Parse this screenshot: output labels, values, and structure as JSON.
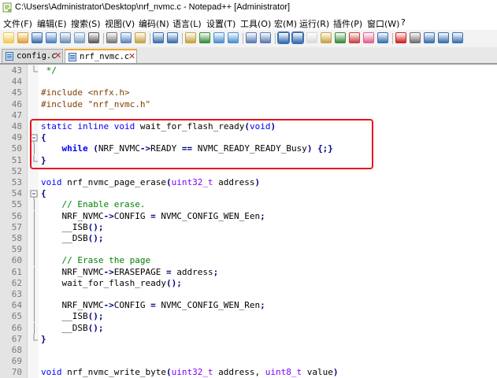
{
  "window": {
    "title": "C:\\Users\\Administrator\\Desktop\\nrf_nvmc.c - Notepad++ [Administrator]"
  },
  "menu": [
    {
      "label": "文件(F)"
    },
    {
      "label": "编辑(E)"
    },
    {
      "label": "搜索(S)"
    },
    {
      "label": "视图(V)"
    },
    {
      "label": "编码(N)"
    },
    {
      "label": "语言(L)"
    },
    {
      "label": "设置(T)"
    },
    {
      "label": "工具(O)"
    },
    {
      "label": "宏(M)"
    },
    {
      "label": "运行(R)"
    },
    {
      "label": "插件(P)"
    },
    {
      "label": "窗口(W)"
    },
    {
      "label": "?"
    }
  ],
  "toolbar_icons": [
    "new-file",
    "open-file",
    "save",
    "save-all",
    "close",
    "close-all",
    "print",
    "cut",
    "copy",
    "paste",
    "undo",
    "redo",
    "find",
    "replace",
    "zoom-in",
    "zoom-out",
    "sync-vertical",
    "sync-horizontal",
    "word-wrap",
    "show-all-chars",
    "indent-guide",
    "user-language",
    "doc-map",
    "function-list",
    "folder-workspace",
    "monitor",
    "record-macro",
    "stop-record",
    "play-macro",
    "run-macro-multiple",
    "save-macro"
  ],
  "tabs": [
    {
      "label": "config.c",
      "active": false
    },
    {
      "label": "nrf_nvmc.c",
      "active": true
    }
  ],
  "editor": {
    "lines": [
      {
        "num": "43",
        "fold": "end",
        "tokens": [
          {
            "t": " */",
            "c": "com"
          }
        ]
      },
      {
        "num": "44",
        "fold": "",
        "tokens": []
      },
      {
        "num": "45",
        "fold": "",
        "tokens": [
          {
            "t": "#include ",
            "c": "pp"
          },
          {
            "t": "<nrfx.h>",
            "c": "pp"
          }
        ]
      },
      {
        "num": "46",
        "fold": "",
        "tokens": [
          {
            "t": "#include ",
            "c": "pp"
          },
          {
            "t": "\"nrf_nvmc.h\"",
            "c": "pp"
          }
        ]
      },
      {
        "num": "47",
        "fold": "",
        "tokens": []
      },
      {
        "num": "48",
        "fold": "",
        "tokens": [
          {
            "t": "static",
            "c": "kw"
          },
          {
            "t": " ",
            "c": "txt"
          },
          {
            "t": "inline",
            "c": "kw"
          },
          {
            "t": " ",
            "c": "txt"
          },
          {
            "t": "void",
            "c": "kw"
          },
          {
            "t": " wait_for_flash_ready",
            "c": "txt"
          },
          {
            "t": "(",
            "c": "op"
          },
          {
            "t": "void",
            "c": "kw"
          },
          {
            "t": ")",
            "c": "op"
          }
        ]
      },
      {
        "num": "49",
        "fold": "open",
        "tokens": [
          {
            "t": "{",
            "c": "op"
          }
        ]
      },
      {
        "num": "50",
        "fold": "mid",
        "tokens": [
          {
            "t": "    ",
            "c": "txt"
          },
          {
            "t": "while",
            "c": "kwb"
          },
          {
            "t": " ",
            "c": "txt"
          },
          {
            "t": "(",
            "c": "op"
          },
          {
            "t": "NRF_NVMC",
            "c": "txt"
          },
          {
            "t": "->",
            "c": "op"
          },
          {
            "t": "READY ",
            "c": "txt"
          },
          {
            "t": "==",
            "c": "op"
          },
          {
            "t": " NVMC_READY_READY_Busy",
            "c": "txt"
          },
          {
            "t": ")",
            "c": "op"
          },
          {
            "t": " ",
            "c": "txt"
          },
          {
            "t": "{;}",
            "c": "op"
          }
        ]
      },
      {
        "num": "51",
        "fold": "end",
        "tokens": [
          {
            "t": "}",
            "c": "op"
          }
        ]
      },
      {
        "num": "52",
        "fold": "",
        "tokens": []
      },
      {
        "num": "53",
        "fold": "",
        "tokens": [
          {
            "t": "void",
            "c": "kw"
          },
          {
            "t": " nrf_nvmc_page_erase",
            "c": "txt"
          },
          {
            "t": "(",
            "c": "op"
          },
          {
            "t": "uint32_t",
            "c": "type"
          },
          {
            "t": " address",
            "c": "txt"
          },
          {
            "t": ")",
            "c": "op"
          }
        ]
      },
      {
        "num": "54",
        "fold": "open",
        "tokens": [
          {
            "t": "{",
            "c": "op"
          }
        ]
      },
      {
        "num": "55",
        "fold": "mid",
        "tokens": [
          {
            "t": "    // Enable erase.",
            "c": "com"
          }
        ]
      },
      {
        "num": "56",
        "fold": "mid",
        "tokens": [
          {
            "t": "    NRF_NVMC",
            "c": "txt"
          },
          {
            "t": "->",
            "c": "op"
          },
          {
            "t": "CONFIG ",
            "c": "txt"
          },
          {
            "t": "=",
            "c": "op"
          },
          {
            "t": " NVMC_CONFIG_WEN_Een",
            "c": "txt"
          },
          {
            "t": ";",
            "c": "op"
          }
        ]
      },
      {
        "num": "57",
        "fold": "mid",
        "tokens": [
          {
            "t": "    __ISB",
            "c": "txt"
          },
          {
            "t": "();",
            "c": "op"
          }
        ]
      },
      {
        "num": "58",
        "fold": "mid",
        "tokens": [
          {
            "t": "    __DSB",
            "c": "txt"
          },
          {
            "t": "();",
            "c": "op"
          }
        ]
      },
      {
        "num": "59",
        "fold": "mid",
        "tokens": []
      },
      {
        "num": "60",
        "fold": "mid",
        "tokens": [
          {
            "t": "    // Erase the page",
            "c": "com"
          }
        ]
      },
      {
        "num": "61",
        "fold": "mid",
        "tokens": [
          {
            "t": "    NRF_NVMC",
            "c": "txt"
          },
          {
            "t": "->",
            "c": "op"
          },
          {
            "t": "ERASEPAGE ",
            "c": "txt"
          },
          {
            "t": "=",
            "c": "op"
          },
          {
            "t": " address",
            "c": "txt"
          },
          {
            "t": ";",
            "c": "op"
          }
        ]
      },
      {
        "num": "62",
        "fold": "mid",
        "tokens": [
          {
            "t": "    wait_for_flash_ready",
            "c": "txt"
          },
          {
            "t": "();",
            "c": "op"
          }
        ]
      },
      {
        "num": "63",
        "fold": "mid",
        "tokens": []
      },
      {
        "num": "64",
        "fold": "mid",
        "tokens": [
          {
            "t": "    NRF_NVMC",
            "c": "txt"
          },
          {
            "t": "->",
            "c": "op"
          },
          {
            "t": "CONFIG ",
            "c": "txt"
          },
          {
            "t": "=",
            "c": "op"
          },
          {
            "t": " NVMC_CONFIG_WEN_Ren",
            "c": "txt"
          },
          {
            "t": ";",
            "c": "op"
          }
        ]
      },
      {
        "num": "65",
        "fold": "mid",
        "tokens": [
          {
            "t": "    __ISB",
            "c": "txt"
          },
          {
            "t": "();",
            "c": "op"
          }
        ]
      },
      {
        "num": "66",
        "fold": "mid",
        "tokens": [
          {
            "t": "    __DSB",
            "c": "txt"
          },
          {
            "t": "();",
            "c": "op"
          }
        ]
      },
      {
        "num": "67",
        "fold": "end",
        "tokens": [
          {
            "t": "}",
            "c": "op"
          }
        ]
      },
      {
        "num": "68",
        "fold": "",
        "tokens": []
      },
      {
        "num": "69",
        "fold": "",
        "tokens": []
      },
      {
        "num": "70",
        "fold": "",
        "tokens": [
          {
            "t": "void",
            "c": "kw"
          },
          {
            "t": " nrf_nvmc_write_byte",
            "c": "txt"
          },
          {
            "t": "(",
            "c": "op"
          },
          {
            "t": "uint32_t",
            "c": "type"
          },
          {
            "t": " address, ",
            "c": "txt"
          },
          {
            "t": "uint8_t",
            "c": "type"
          },
          {
            "t": " value",
            "c": "txt"
          },
          {
            "t": ")",
            "c": "op"
          }
        ]
      }
    ]
  },
  "annotation": {
    "color": "#e8141e"
  }
}
